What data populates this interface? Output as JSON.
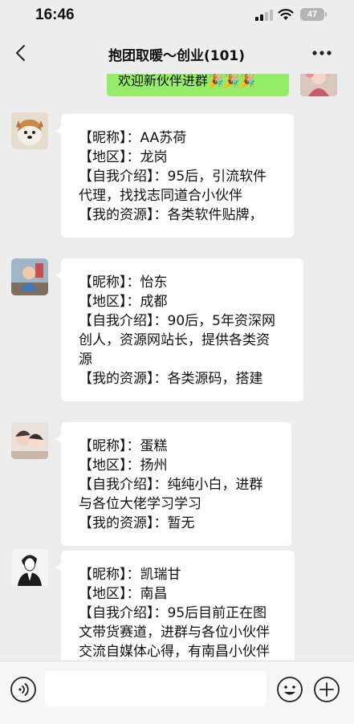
{
  "status_bar": {
    "time": "16:46",
    "battery": "47"
  },
  "nav": {
    "title": "抱团取暖～创业(101)"
  },
  "self_message": {
    "text": "欢迎新伙伴进群🎉🎉🎉"
  },
  "messages": [
    {
      "lines": [
        "【昵称】：AA苏荷",
        "【地区】：龙岗",
        "【自我介绍】：95后，引流软件",
        "代理，找找志同道合小伙伴",
        "【我的资源】：各类软件贴牌，"
      ]
    },
    {
      "lines": [
        "【昵称】：怡东",
        "【地区】：成都",
        "【自我介绍】：90后，5年资深网",
        "创人，资源网站长，提供各类资",
        "源",
        "【我的资源】：各类源码，搭建"
      ]
    },
    {
      "lines": [
        "【昵称】：蛋糕",
        "【地区】：扬州",
        "【自我介绍】：纯纯小白，进群",
        "与各位大佬学习学习",
        "【我的资源】：暂无"
      ]
    },
    {
      "lines": [
        "【昵称】：凯瑞甘",
        "【地区】：南昌",
        "【自我介绍】：95后目前正在图",
        "文带货赛道，进群与各位小伙伴",
        "交流自媒体心得，有南昌小伙伴"
      ]
    }
  ],
  "input": {
    "value": ""
  },
  "icons": {
    "back": "chevron-left-icon",
    "more": "more-dots-icon",
    "voice": "voice-icon",
    "emoji": "emoji-icon",
    "plus": "plus-icon",
    "signal": "signal-icon",
    "wifi": "wifi-icon"
  }
}
